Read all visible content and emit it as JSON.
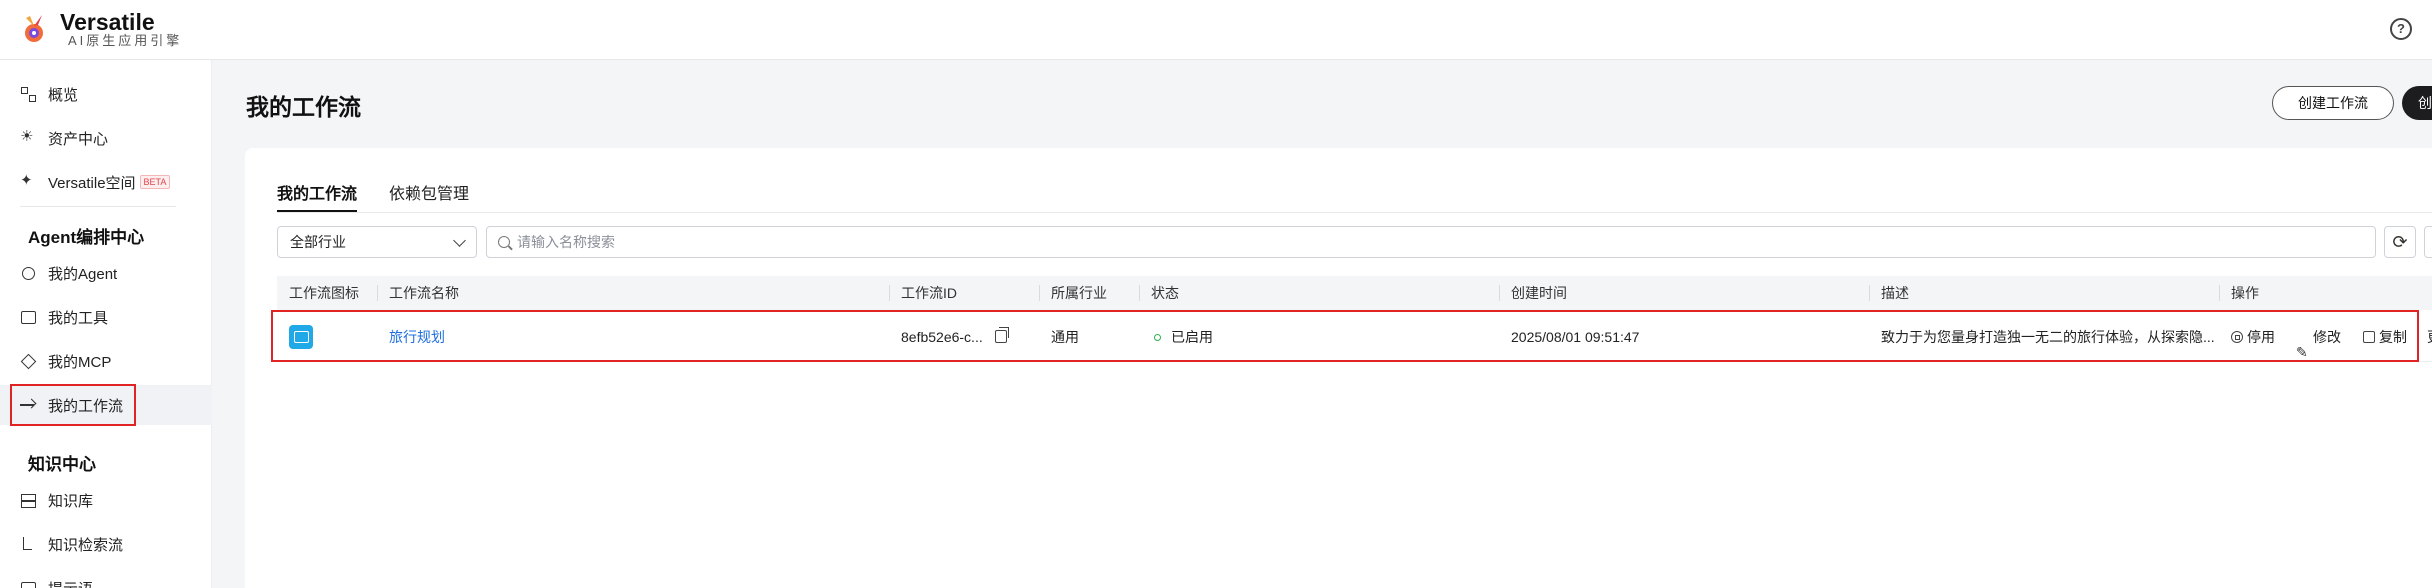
{
  "app": {
    "brand_name": "Versatile",
    "brand_sub": "AI原生应用引擎",
    "help_symbol": "?"
  },
  "sidebar": {
    "items_top": [
      {
        "label": "概览",
        "icon": "grid-icon"
      },
      {
        "label": "资产中心",
        "icon": "bulb-icon"
      },
      {
        "label": "Versatile空间",
        "icon": "sparkle-icon",
        "badge": "BETA"
      }
    ],
    "section_agent": "Agent编排中心",
    "items_agent": [
      {
        "label": "我的Agent",
        "icon": "cube-icon"
      },
      {
        "label": "我的工具",
        "icon": "layers-icon"
      },
      {
        "label": "我的MCP",
        "icon": "diamond-icon"
      },
      {
        "label": "我的工作流",
        "icon": "workflow-icon",
        "active": true
      }
    ],
    "section_knowledge": "知识中心",
    "items_knowledge": [
      {
        "label": "知识库",
        "icon": "database-icon"
      },
      {
        "label": "知识检索流",
        "icon": "branch-icon"
      },
      {
        "label": "提示语",
        "icon": "prompt-icon"
      }
    ]
  },
  "main": {
    "page_title": "我的工作流",
    "create_button": "创建工作流",
    "dark_button": "创",
    "tabs": [
      "我的工作流",
      "依赖包管理"
    ],
    "filter_select": "全部行业",
    "search_placeholder": "请输入名称搜索",
    "table": {
      "headers": [
        "工作流图标",
        "工作流名称",
        "工作流ID",
        "所属行业",
        "状态",
        "创建时间",
        "描述",
        "操作"
      ],
      "rows": [
        {
          "name": "旅行规划",
          "id": "8efb52e6-c...",
          "industry": "通用",
          "status": "已启用",
          "created": "2025/08/01 09:51:47",
          "description": "致力于为您量身打造独一无二的旅行体验，从探索隐...",
          "actions": [
            "停用",
            "修改",
            "复制",
            "更"
          ]
        }
      ]
    }
  },
  "colors": {
    "accent_link": "#1d6fe0",
    "status_ok": "#2bb24c",
    "highlight": "#e02424",
    "workflow_icon_bg": "#21a8e6"
  }
}
